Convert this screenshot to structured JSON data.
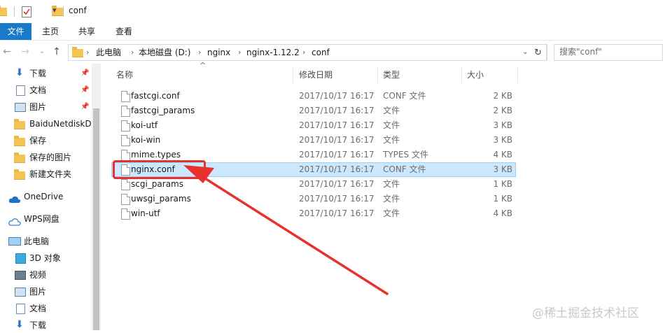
{
  "window": {
    "title": "conf"
  },
  "ribbon": {
    "tabs": [
      {
        "label": "文件",
        "active": true
      },
      {
        "label": "主页",
        "active": false
      },
      {
        "label": "共享",
        "active": false
      },
      {
        "label": "查看",
        "active": false
      }
    ]
  },
  "address": {
    "crumbs": [
      "此电脑",
      "本地磁盘 (D:)",
      "nginx",
      "nginx-1.12.2",
      "conf"
    ]
  },
  "search": {
    "placeholder": "搜索\"conf\""
  },
  "sidebar": {
    "items": [
      {
        "label": "下载",
        "icon": "download-icon",
        "pinned": true
      },
      {
        "label": "文档",
        "icon": "document-icon",
        "pinned": true
      },
      {
        "label": "图片",
        "icon": "picture-icon",
        "pinned": true
      },
      {
        "label": "BaiduNetdiskD",
        "icon": "folder-icon",
        "pinned": false
      },
      {
        "label": "保存",
        "icon": "folder-icon",
        "pinned": false
      },
      {
        "label": "保存的图片",
        "icon": "folder-icon",
        "pinned": false
      },
      {
        "label": "新建文件夹",
        "icon": "folder-icon",
        "pinned": false
      },
      {
        "label": "OneDrive",
        "icon": "cloud-icon",
        "pinned": false
      },
      {
        "label": "WPS网盘",
        "icon": "cloud-outline-icon",
        "pinned": false
      },
      {
        "label": "此电脑",
        "icon": "computer-icon",
        "pinned": false
      },
      {
        "label": "3D 对象",
        "icon": "cube-icon",
        "pinned": false
      },
      {
        "label": "视频",
        "icon": "video-icon",
        "pinned": false
      },
      {
        "label": "图片",
        "icon": "picture-icon",
        "pinned": false
      },
      {
        "label": "文档",
        "icon": "document-icon",
        "pinned": false
      },
      {
        "label": "下载",
        "icon": "download-icon",
        "pinned": false
      }
    ]
  },
  "columns": {
    "name": "名称",
    "date": "修改日期",
    "type": "类型",
    "size": "大小"
  },
  "files": [
    {
      "name": "fastcgi.conf",
      "date": "2017/10/17 16:17",
      "type": "CONF 文件",
      "size": "2 KB",
      "selected": false
    },
    {
      "name": "fastcgi_params",
      "date": "2017/10/17 16:17",
      "type": "文件",
      "size": "2 KB",
      "selected": false
    },
    {
      "name": "koi-utf",
      "date": "2017/10/17 16:17",
      "type": "文件",
      "size": "3 KB",
      "selected": false
    },
    {
      "name": "koi-win",
      "date": "2017/10/17 16:17",
      "type": "文件",
      "size": "3 KB",
      "selected": false
    },
    {
      "name": "mime.types",
      "date": "2017/10/17 16:17",
      "type": "TYPES 文件",
      "size": "4 KB",
      "selected": false
    },
    {
      "name": "nginx.conf",
      "date": "2017/10/17 16:17",
      "type": "CONF 文件",
      "size": "3 KB",
      "selected": true
    },
    {
      "name": "scgi_params",
      "date": "2017/10/17 16:17",
      "type": "文件",
      "size": "1 KB",
      "selected": false
    },
    {
      "name": "uwsgi_params",
      "date": "2017/10/17 16:17",
      "type": "文件",
      "size": "1 KB",
      "selected": false
    },
    {
      "name": "win-utf",
      "date": "2017/10/17 16:17",
      "type": "文件",
      "size": "4 KB",
      "selected": false
    }
  ],
  "watermark": "@稀土掘金技术社区",
  "colors": {
    "ribbon_active": "#1979ca",
    "selection_bg": "#cce8ff",
    "selection_border": "#99d1ff",
    "annotation_red": "#e8312c",
    "folder_yellow": "#f4c553"
  }
}
